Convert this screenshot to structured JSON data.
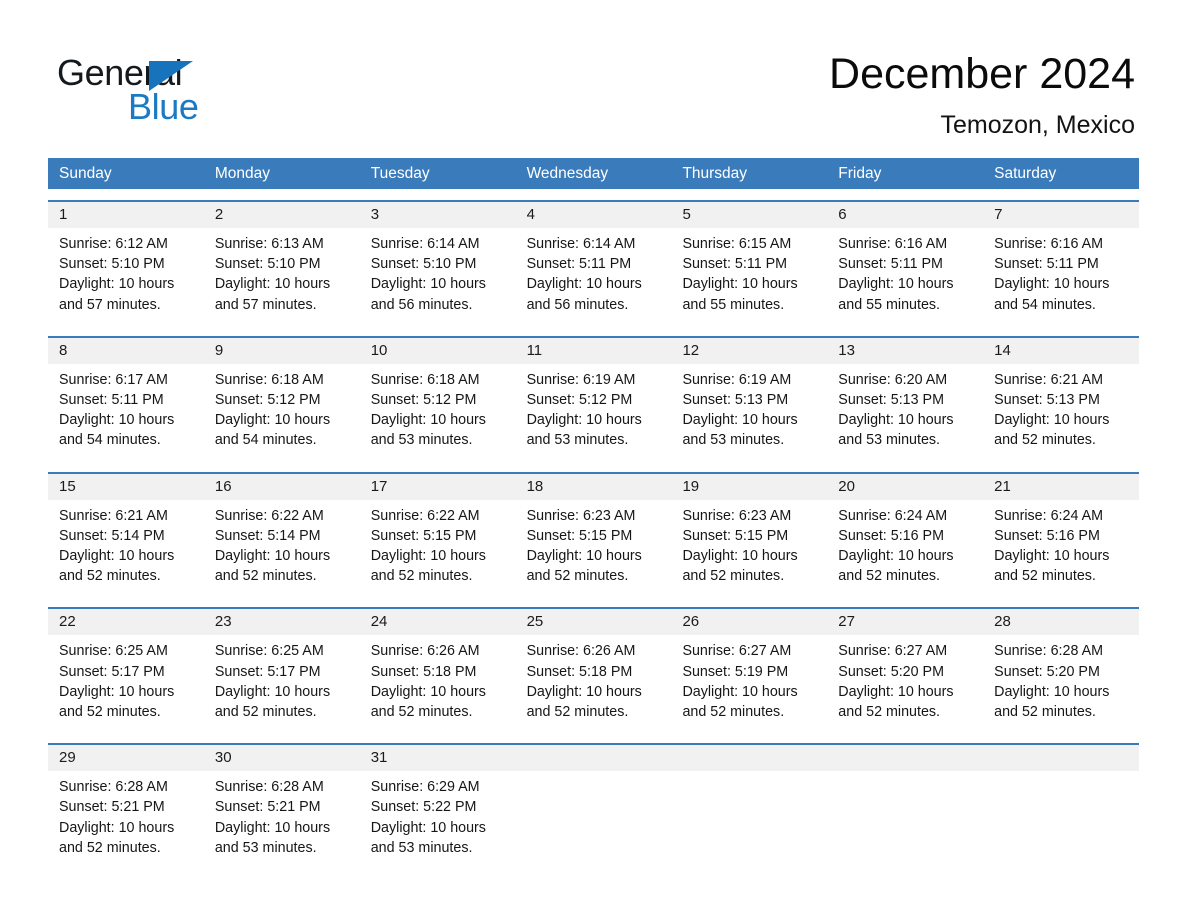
{
  "brand": {
    "name_part1": "General",
    "name_part2": "Blue",
    "triangle_color": "#1773bb",
    "blue_color": "#1b7ac4"
  },
  "header": {
    "title": "December 2024",
    "location": "Temozon, Mexico"
  },
  "theme": {
    "header_blue": "#3a7cbb",
    "day_band_gray": "#f1f1f1",
    "text_color": "#161616"
  },
  "weekdays": [
    "Sunday",
    "Monday",
    "Tuesday",
    "Wednesday",
    "Thursday",
    "Friday",
    "Saturday"
  ],
  "weeks": [
    [
      {
        "day": "1",
        "sunrise": "Sunrise: 6:12 AM",
        "sunset": "Sunset: 5:10 PM",
        "daylight_line1": "Daylight: 10 hours",
        "daylight_line2": "and 57 minutes."
      },
      {
        "day": "2",
        "sunrise": "Sunrise: 6:13 AM",
        "sunset": "Sunset: 5:10 PM",
        "daylight_line1": "Daylight: 10 hours",
        "daylight_line2": "and 57 minutes."
      },
      {
        "day": "3",
        "sunrise": "Sunrise: 6:14 AM",
        "sunset": "Sunset: 5:10 PM",
        "daylight_line1": "Daylight: 10 hours",
        "daylight_line2": "and 56 minutes."
      },
      {
        "day": "4",
        "sunrise": "Sunrise: 6:14 AM",
        "sunset": "Sunset: 5:11 PM",
        "daylight_line1": "Daylight: 10 hours",
        "daylight_line2": "and 56 minutes."
      },
      {
        "day": "5",
        "sunrise": "Sunrise: 6:15 AM",
        "sunset": "Sunset: 5:11 PM",
        "daylight_line1": "Daylight: 10 hours",
        "daylight_line2": "and 55 minutes."
      },
      {
        "day": "6",
        "sunrise": "Sunrise: 6:16 AM",
        "sunset": "Sunset: 5:11 PM",
        "daylight_line1": "Daylight: 10 hours",
        "daylight_line2": "and 55 minutes."
      },
      {
        "day": "7",
        "sunrise": "Sunrise: 6:16 AM",
        "sunset": "Sunset: 5:11 PM",
        "daylight_line1": "Daylight: 10 hours",
        "daylight_line2": "and 54 minutes."
      }
    ],
    [
      {
        "day": "8",
        "sunrise": "Sunrise: 6:17 AM",
        "sunset": "Sunset: 5:11 PM",
        "daylight_line1": "Daylight: 10 hours",
        "daylight_line2": "and 54 minutes."
      },
      {
        "day": "9",
        "sunrise": "Sunrise: 6:18 AM",
        "sunset": "Sunset: 5:12 PM",
        "daylight_line1": "Daylight: 10 hours",
        "daylight_line2": "and 54 minutes."
      },
      {
        "day": "10",
        "sunrise": "Sunrise: 6:18 AM",
        "sunset": "Sunset: 5:12 PM",
        "daylight_line1": "Daylight: 10 hours",
        "daylight_line2": "and 53 minutes."
      },
      {
        "day": "11",
        "sunrise": "Sunrise: 6:19 AM",
        "sunset": "Sunset: 5:12 PM",
        "daylight_line1": "Daylight: 10 hours",
        "daylight_line2": "and 53 minutes."
      },
      {
        "day": "12",
        "sunrise": "Sunrise: 6:19 AM",
        "sunset": "Sunset: 5:13 PM",
        "daylight_line1": "Daylight: 10 hours",
        "daylight_line2": "and 53 minutes."
      },
      {
        "day": "13",
        "sunrise": "Sunrise: 6:20 AM",
        "sunset": "Sunset: 5:13 PM",
        "daylight_line1": "Daylight: 10 hours",
        "daylight_line2": "and 53 minutes."
      },
      {
        "day": "14",
        "sunrise": "Sunrise: 6:21 AM",
        "sunset": "Sunset: 5:13 PM",
        "daylight_line1": "Daylight: 10 hours",
        "daylight_line2": "and 52 minutes."
      }
    ],
    [
      {
        "day": "15",
        "sunrise": "Sunrise: 6:21 AM",
        "sunset": "Sunset: 5:14 PM",
        "daylight_line1": "Daylight: 10 hours",
        "daylight_line2": "and 52 minutes."
      },
      {
        "day": "16",
        "sunrise": "Sunrise: 6:22 AM",
        "sunset": "Sunset: 5:14 PM",
        "daylight_line1": "Daylight: 10 hours",
        "daylight_line2": "and 52 minutes."
      },
      {
        "day": "17",
        "sunrise": "Sunrise: 6:22 AM",
        "sunset": "Sunset: 5:15 PM",
        "daylight_line1": "Daylight: 10 hours",
        "daylight_line2": "and 52 minutes."
      },
      {
        "day": "18",
        "sunrise": "Sunrise: 6:23 AM",
        "sunset": "Sunset: 5:15 PM",
        "daylight_line1": "Daylight: 10 hours",
        "daylight_line2": "and 52 minutes."
      },
      {
        "day": "19",
        "sunrise": "Sunrise: 6:23 AM",
        "sunset": "Sunset: 5:15 PM",
        "daylight_line1": "Daylight: 10 hours",
        "daylight_line2": "and 52 minutes."
      },
      {
        "day": "20",
        "sunrise": "Sunrise: 6:24 AM",
        "sunset": "Sunset: 5:16 PM",
        "daylight_line1": "Daylight: 10 hours",
        "daylight_line2": "and 52 minutes."
      },
      {
        "day": "21",
        "sunrise": "Sunrise: 6:24 AM",
        "sunset": "Sunset: 5:16 PM",
        "daylight_line1": "Daylight: 10 hours",
        "daylight_line2": "and 52 minutes."
      }
    ],
    [
      {
        "day": "22",
        "sunrise": "Sunrise: 6:25 AM",
        "sunset": "Sunset: 5:17 PM",
        "daylight_line1": "Daylight: 10 hours",
        "daylight_line2": "and 52 minutes."
      },
      {
        "day": "23",
        "sunrise": "Sunrise: 6:25 AM",
        "sunset": "Sunset: 5:17 PM",
        "daylight_line1": "Daylight: 10 hours",
        "daylight_line2": "and 52 minutes."
      },
      {
        "day": "24",
        "sunrise": "Sunrise: 6:26 AM",
        "sunset": "Sunset: 5:18 PM",
        "daylight_line1": "Daylight: 10 hours",
        "daylight_line2": "and 52 minutes."
      },
      {
        "day": "25",
        "sunrise": "Sunrise: 6:26 AM",
        "sunset": "Sunset: 5:18 PM",
        "daylight_line1": "Daylight: 10 hours",
        "daylight_line2": "and 52 minutes."
      },
      {
        "day": "26",
        "sunrise": "Sunrise: 6:27 AM",
        "sunset": "Sunset: 5:19 PM",
        "daylight_line1": "Daylight: 10 hours",
        "daylight_line2": "and 52 minutes."
      },
      {
        "day": "27",
        "sunrise": "Sunrise: 6:27 AM",
        "sunset": "Sunset: 5:20 PM",
        "daylight_line1": "Daylight: 10 hours",
        "daylight_line2": "and 52 minutes."
      },
      {
        "day": "28",
        "sunrise": "Sunrise: 6:28 AM",
        "sunset": "Sunset: 5:20 PM",
        "daylight_line1": "Daylight: 10 hours",
        "daylight_line2": "and 52 minutes."
      }
    ],
    [
      {
        "day": "29",
        "sunrise": "Sunrise: 6:28 AM",
        "sunset": "Sunset: 5:21 PM",
        "daylight_line1": "Daylight: 10 hours",
        "daylight_line2": "and 52 minutes."
      },
      {
        "day": "30",
        "sunrise": "Sunrise: 6:28 AM",
        "sunset": "Sunset: 5:21 PM",
        "daylight_line1": "Daylight: 10 hours",
        "daylight_line2": "and 53 minutes."
      },
      {
        "day": "31",
        "sunrise": "Sunrise: 6:29 AM",
        "sunset": "Sunset: 5:22 PM",
        "daylight_line1": "Daylight: 10 hours",
        "daylight_line2": "and 53 minutes."
      },
      {
        "day": "",
        "sunrise": "",
        "sunset": "",
        "daylight_line1": "",
        "daylight_line2": ""
      },
      {
        "day": "",
        "sunrise": "",
        "sunset": "",
        "daylight_line1": "",
        "daylight_line2": ""
      },
      {
        "day": "",
        "sunrise": "",
        "sunset": "",
        "daylight_line1": "",
        "daylight_line2": ""
      },
      {
        "day": "",
        "sunrise": "",
        "sunset": "",
        "daylight_line1": "",
        "daylight_line2": ""
      }
    ]
  ]
}
